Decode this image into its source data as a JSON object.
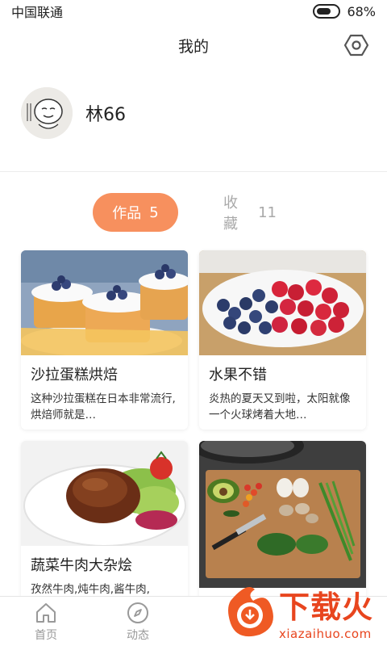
{
  "status_bar": {
    "carrier": "中国联通",
    "battery_percent": "68%",
    "battery_level": 0.68
  },
  "header": {
    "title": "我的",
    "settings_icon": "hexagon-settings-icon"
  },
  "profile": {
    "username": "林66",
    "avatar_icon": "avatar-cartoon-face"
  },
  "tabs": [
    {
      "label": "作品",
      "count": "5",
      "active": true
    },
    {
      "label": "收藏",
      "count": "11",
      "active": false
    }
  ],
  "cards": [
    {
      "title": "沙拉蛋糕烘焙",
      "desc": "这种沙拉蛋糕在日本非常流行,烘焙师就是…",
      "image": "blueberry-cakes"
    },
    {
      "title": "水果不错",
      "desc": "炎热的夏天又到啦，太阳就像一个火球烤着大地…",
      "image": "berries-plate"
    },
    {
      "title": "蔬菜牛肉大杂烩",
      "desc": "孜然牛肉,炖牛肉,酱牛肉,",
      "image": "beef-salad-bowl"
    },
    {
      "title": "",
      "desc": "",
      "image": "vegetables-cutting-board"
    }
  ],
  "bottom_nav": [
    {
      "label": "首页",
      "icon": "home-icon"
    },
    {
      "label": "动态",
      "icon": "compass-icon"
    }
  ],
  "watermark": {
    "text": "下载火",
    "url": "xiazaihuo.com"
  },
  "colors": {
    "accent": "#f7905e",
    "watermark": "#e8451e"
  }
}
